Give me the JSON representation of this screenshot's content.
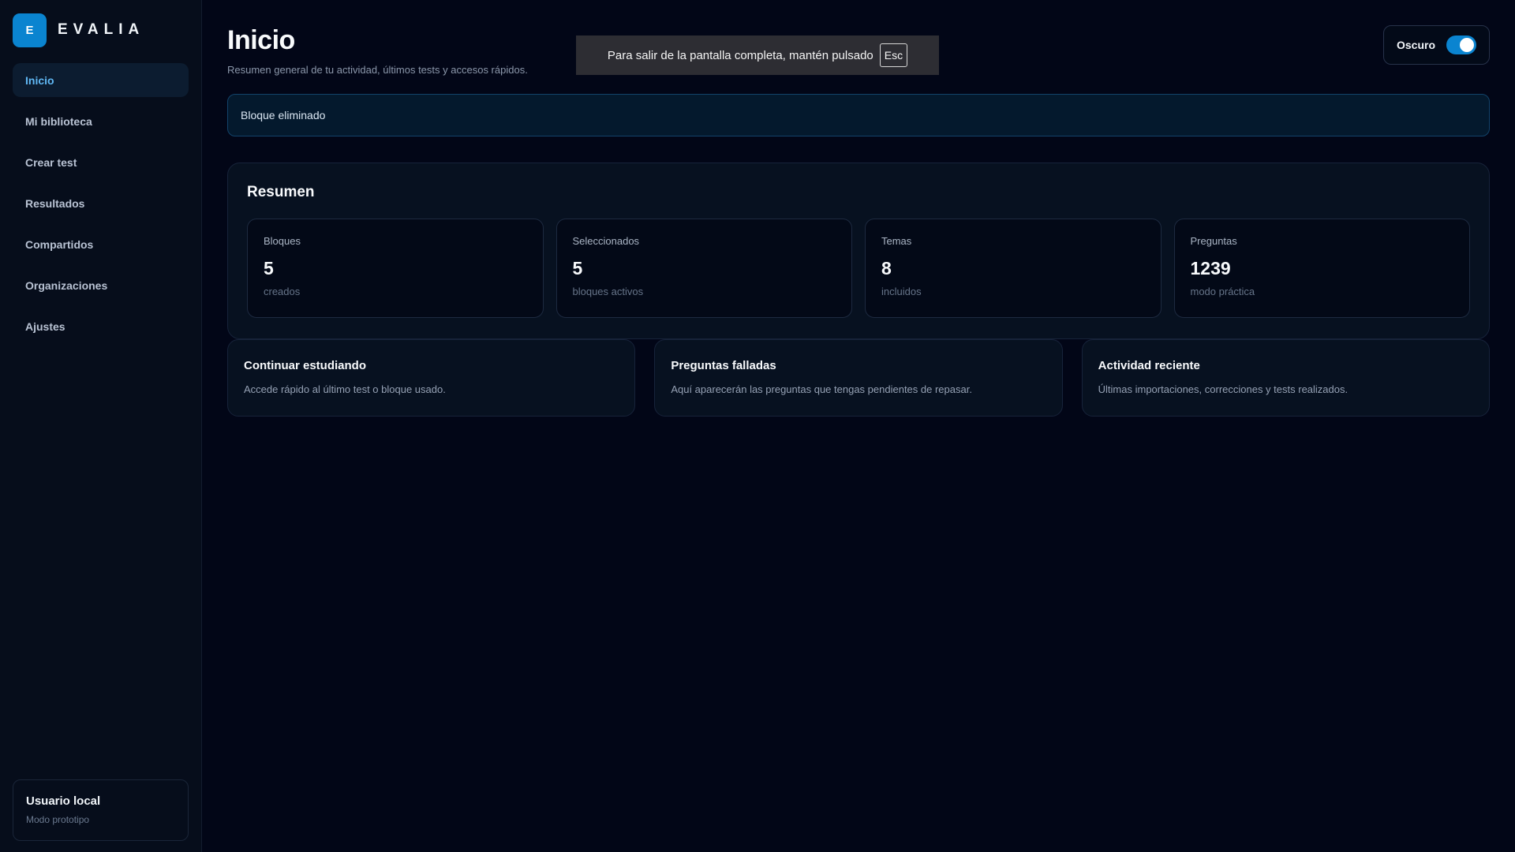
{
  "logo": {
    "mark": "E",
    "name": "EVALIA"
  },
  "sidebar": {
    "items": [
      {
        "label": "Inicio",
        "active": true
      },
      {
        "label": "Mi biblioteca"
      },
      {
        "label": "Crear test"
      },
      {
        "label": "Resultados"
      },
      {
        "label": "Compartidos"
      },
      {
        "label": "Organizaciones"
      },
      {
        "label": "Ajustes"
      }
    ],
    "user": {
      "name": "Usuario local",
      "subtitle": "Modo prototipo"
    }
  },
  "header": {
    "title": "Inicio",
    "subtitle": "Resumen general de tu actividad, últimos tests y accesos rápidos."
  },
  "fullscreen_toast": {
    "text": "Para salir de la pantalla completa, mantén pulsado",
    "key": "Esc"
  },
  "theme_toggle": {
    "label": "Oscuro",
    "on": true
  },
  "alert": {
    "text": "Bloque eliminado"
  },
  "summary": {
    "title": "Resumen",
    "stats": [
      {
        "label": "Bloques",
        "value": "5",
        "sub": "creados"
      },
      {
        "label": "Seleccionados",
        "value": "5",
        "sub": "bloques activos"
      },
      {
        "label": "Temas",
        "value": "8",
        "sub": "incluidos"
      },
      {
        "label": "Preguntas",
        "value": "1239",
        "sub": "modo práctica"
      }
    ]
  },
  "cards": [
    {
      "title": "Continuar estudiando",
      "desc": "Accede rápido al último test o bloque usado."
    },
    {
      "title": "Preguntas falladas",
      "desc": "Aquí aparecerán las preguntas que tengas pendientes de repasar."
    },
    {
      "title": "Actividad reciente",
      "desc": "Últimas importaciones, correcciones y tests realizados."
    }
  ],
  "colors": {
    "accent": "#0a84d0",
    "background": "#020617",
    "active_nav_text": "#60b8f4"
  }
}
